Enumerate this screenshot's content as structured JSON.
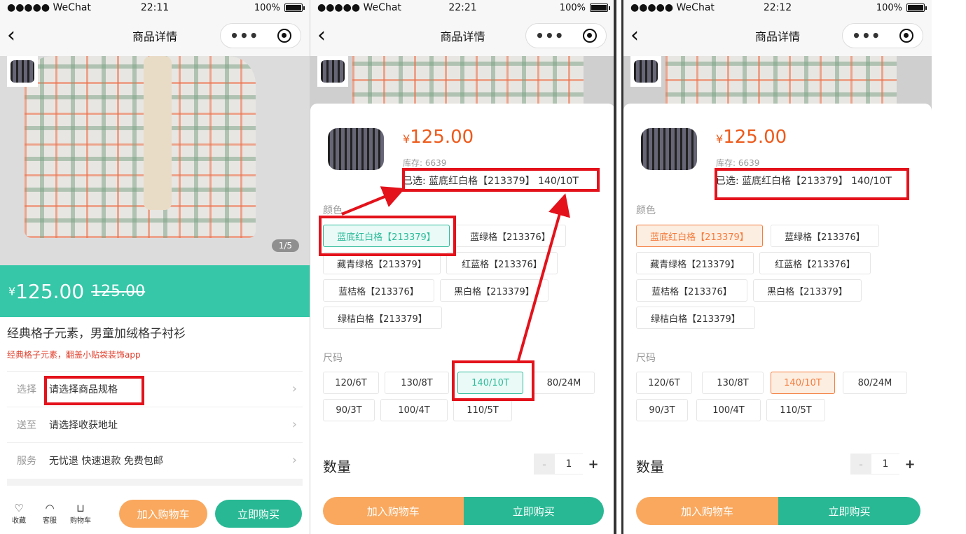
{
  "status": {
    "carrier": "●●●●● WeChat",
    "battery": "100%"
  },
  "nav": {
    "title": "商品详情",
    "more": "•••"
  },
  "panel1": {
    "time": "22:11",
    "pager": "1/5",
    "price_currency": "¥",
    "price": "125.00",
    "price_old": "125.00",
    "name": "经典格子元素，男童加绒格子衬衫",
    "subtitle": "经典格子元素，翻盖小贴袋装饰app",
    "rows": [
      {
        "label": "选择",
        "value": "请选择商品规格"
      },
      {
        "label": "送至",
        "value": "请选择收获地址"
      },
      {
        "label": "服务",
        "value": "无忧退 快速退款 免费包邮"
      }
    ],
    "bottom_icons": [
      "收藏",
      "客服",
      "购物车"
    ],
    "add_cart": "加入购物车",
    "buy_now": "立即购买"
  },
  "sku": {
    "currency": "¥",
    "price": "125.00",
    "stock": "库存: 6639",
    "selected": "已选: 蓝底红白格【213379】 140/10T",
    "color_title": "颜色",
    "colors": [
      "蓝底红白格【213379】",
      "蓝绿格【213376】",
      "藏青绿格【213379】",
      "红蓝格【213376】",
      "蓝桔格【213376】",
      "黑白格【213379】",
      "绿桔白格【213379】"
    ],
    "size_title": "尺码",
    "sizes": [
      "120/6T",
      "130/8T",
      "140/10T",
      "80/24M",
      "90/3T",
      "100/4T",
      "110/5T"
    ],
    "qty_label": "数量",
    "qty_minus": "-",
    "qty_value": "1",
    "qty_plus": "+",
    "add_cart": "加入购物车",
    "buy_now": "立即购买"
  },
  "panel2": {
    "time": "22:21"
  },
  "panel3": {
    "time": "22:12"
  },
  "colors_theme": {
    "accent_green": "#35c7a8",
    "accent_orange": "#f9a85e",
    "sel_orange": "#f47c3c",
    "annotation_red": "#e3121b"
  }
}
